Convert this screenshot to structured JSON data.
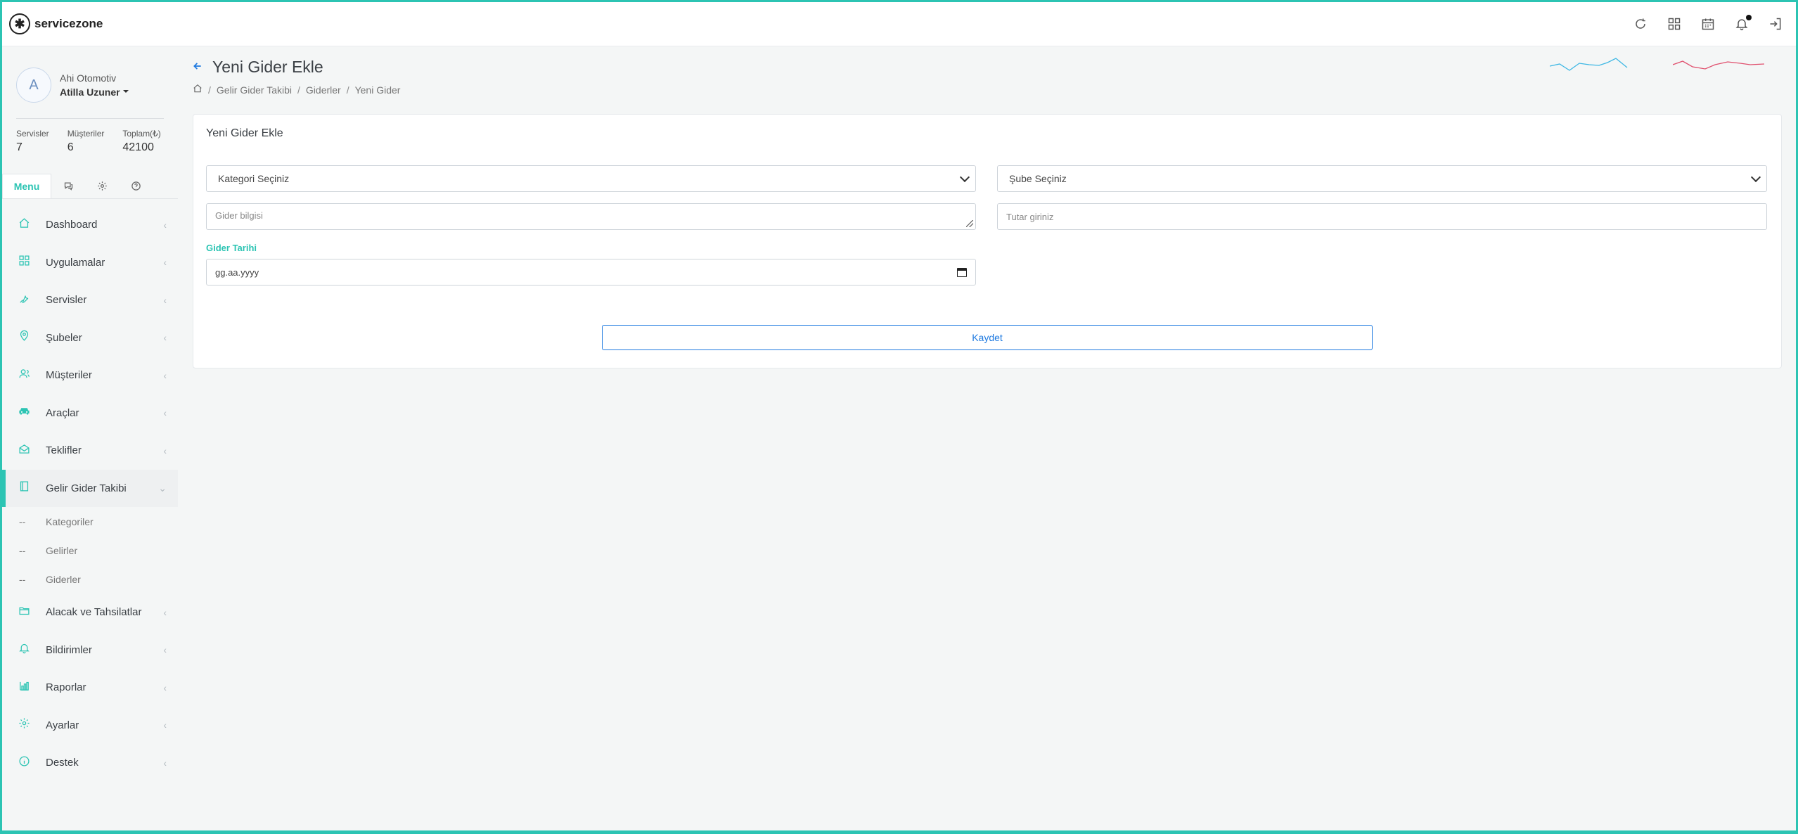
{
  "app": {
    "brand": "servicezone"
  },
  "topbar": {
    "icons": [
      "refresh-icon",
      "apps-grid-icon",
      "calendar-icon",
      "bell-icon",
      "logout-icon"
    ]
  },
  "profile": {
    "initial": "A",
    "company": "Ahi Otomotiv",
    "user": "Atilla Uzuner"
  },
  "stats": [
    {
      "label": "Servisler",
      "value": "7"
    },
    {
      "label": "Müşteriler",
      "value": "6"
    },
    {
      "label": "Toplam(₺)",
      "value": "42100"
    }
  ],
  "tabs": {
    "menu": "Menu"
  },
  "menu": [
    {
      "label": "Dashboard",
      "icon": "home-icon"
    },
    {
      "label": "Uygulamalar",
      "icon": "grid-icon"
    },
    {
      "label": "Servisler",
      "icon": "wrench-icon"
    },
    {
      "label": "Şubeler",
      "icon": "location-pin-icon"
    },
    {
      "label": "Müşteriler",
      "icon": "users-icon"
    },
    {
      "label": "Araçlar",
      "icon": "car-icon"
    },
    {
      "label": "Teklifler",
      "icon": "mail-open-icon"
    },
    {
      "label": "Gelir Gider Takibi",
      "icon": "book-icon"
    }
  ],
  "submenu": [
    {
      "label": "Kategoriler"
    },
    {
      "label": "Gelirler"
    },
    {
      "label": "Giderler"
    }
  ],
  "menu_after": [
    {
      "label": "Alacak ve Tahsilatlar",
      "icon": "folder-icon"
    },
    {
      "label": "Bildirimler",
      "icon": "bell-icon"
    },
    {
      "label": "Raporlar",
      "icon": "bar-chart-icon"
    },
    {
      "label": "Ayarlar",
      "icon": "gear-icon"
    },
    {
      "label": "Destek",
      "icon": "info-icon"
    }
  ],
  "page": {
    "title": "Yeni Gider Ekle",
    "breadcrumb": [
      "Gelir Gider Takibi",
      "Giderler",
      "Yeni Gider"
    ]
  },
  "form": {
    "card_title": "Yeni Gider Ekle",
    "category_select": "Kategori Seçiniz",
    "branch_select": "Şube Seçiniz",
    "info_placeholder": "Gider bilgisi",
    "amount_placeholder": "Tutar giriniz",
    "date_label": "Gider Tarihi",
    "date_placeholder": "gg.aa.yyyy",
    "save_label": "Kaydet"
  },
  "colors": {
    "accent": "#2cc4b3",
    "primary": "#1f7ae0",
    "spark_blue": "#3db7e4",
    "spark_red": "#e0506e"
  }
}
